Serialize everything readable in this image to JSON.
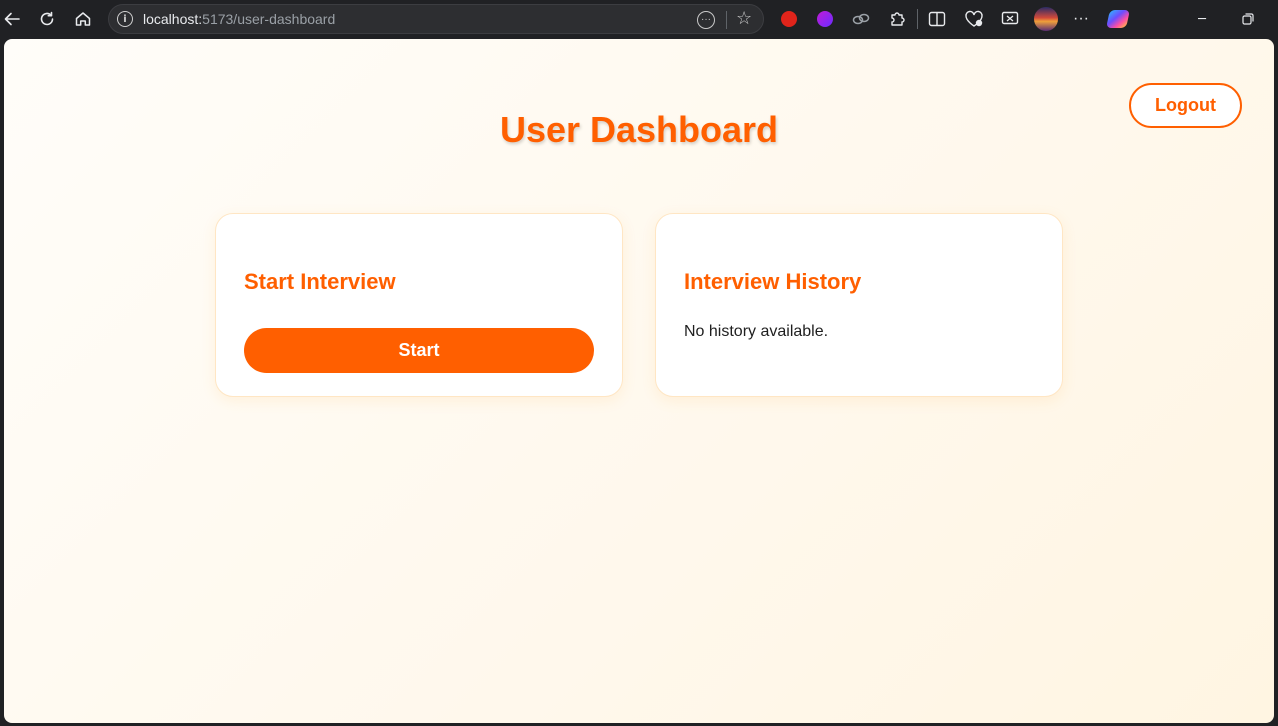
{
  "browser": {
    "url_host": "localhost:",
    "url_path": "5173/user-dashboard"
  },
  "page": {
    "title": "User Dashboard",
    "logout_label": "Logout",
    "start_card": {
      "title": "Start Interview",
      "button_label": "Start"
    },
    "history_card": {
      "title": "Interview History",
      "empty_text": "No history available."
    }
  },
  "colors": {
    "accent": "#ff5f00",
    "chrome_bg": "#202124",
    "card_border": "#ffe6c4"
  },
  "icons": {
    "back": "back-arrow-icon",
    "reload": "reload-icon",
    "home": "home-icon",
    "site_info": "info-icon",
    "page_actions": "more-horizontal-icon",
    "favorite": "star-icon",
    "extensions": [
      "adblock-icon",
      "extension-icon",
      "link-icon",
      "puzzle-icon",
      "split-screen-icon",
      "health-icon",
      "screenshot-icon",
      "profile-avatar-icon",
      "more-icon",
      "copilot-icon"
    ],
    "window": [
      "minimize-icon",
      "restore-icon"
    ]
  }
}
